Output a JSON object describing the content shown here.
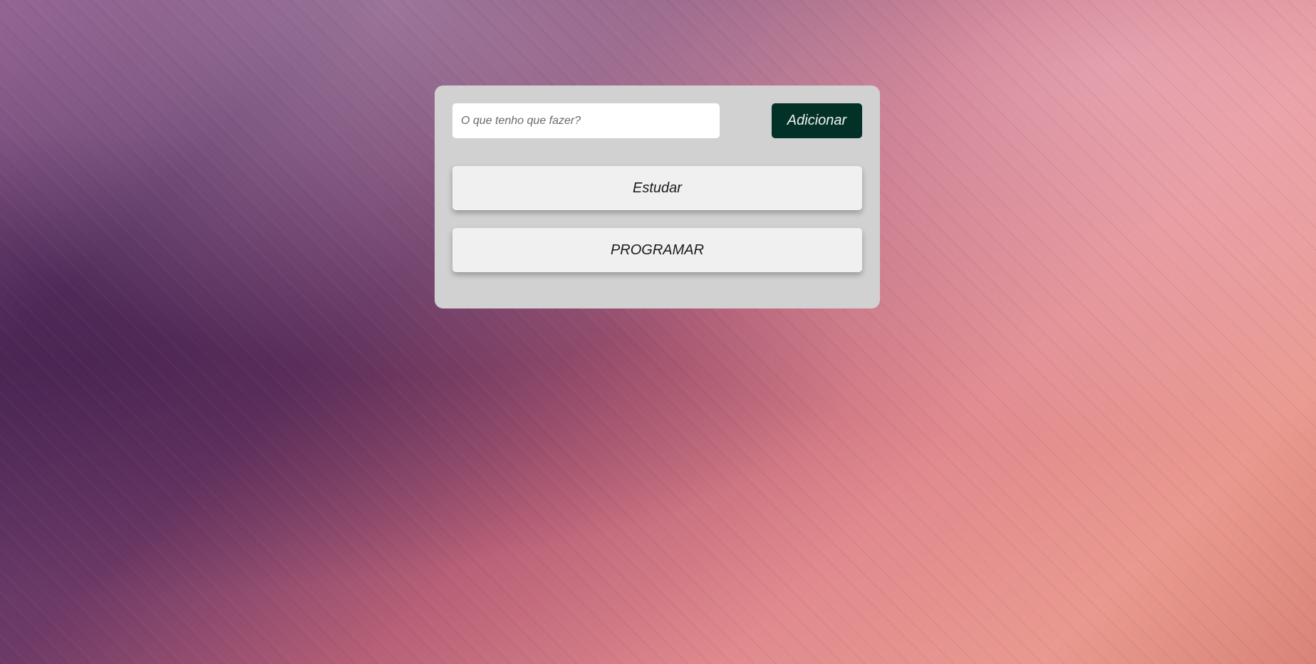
{
  "todo": {
    "input_placeholder": "O que tenho que fazer?",
    "input_value": "",
    "add_button_label": "Adicionar",
    "tasks": [
      {
        "label": "Estudar"
      },
      {
        "label": "PROGRAMAR"
      }
    ]
  },
  "colors": {
    "card_background": "#d1d1d1",
    "add_button_background": "#023128",
    "add_button_text": "#f2f2f2",
    "task_background": "#f0f0f0"
  }
}
